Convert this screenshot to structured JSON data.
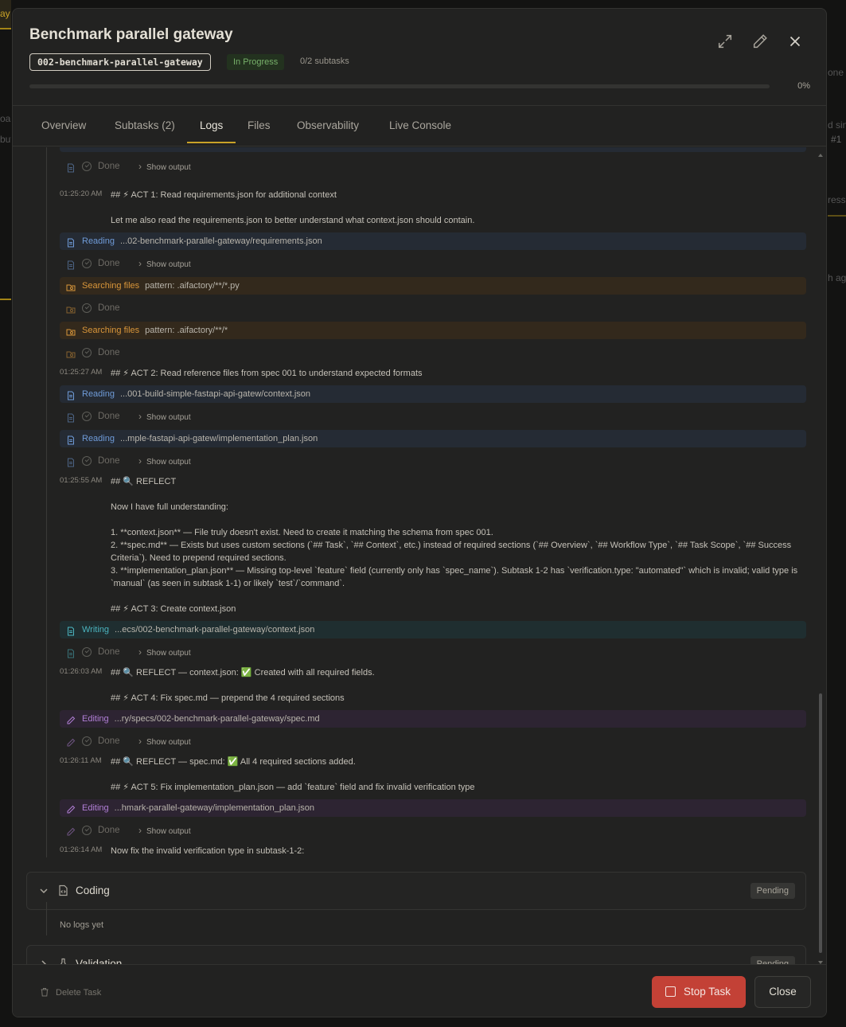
{
  "header": {
    "title": "Benchmark parallel gateway",
    "spec_id": "002-benchmark-parallel-gateway",
    "status": "In Progress",
    "subtasks": "0/2 subtasks",
    "progress_label": "0%",
    "progress": 0
  },
  "tabs": [
    "Overview",
    "Subtasks (2)",
    "Logs",
    "Files",
    "Observability",
    "Live Console"
  ],
  "active_tab": "Logs",
  "labels": {
    "done": "Done",
    "show_output": "Show output"
  },
  "log": {
    "ts1": "01:25:20 AM",
    "msg1": "## ⚡ ACT 1: Read requirements.json for additional context",
    "msg1b": "Let me also read the requirements.json to better understand what context.json should contain.",
    "read1": {
      "name": "Reading",
      "path": "...02-benchmark-parallel-gateway/requirements.json"
    },
    "search1": {
      "name": "Searching files",
      "path": "pattern: .aifactory/**/*.py"
    },
    "search2": {
      "name": "Searching files",
      "path": "pattern: .aifactory/**/*"
    },
    "ts2": "01:25:27 AM",
    "msg2": "## ⚡ ACT 2: Read reference files from spec 001 to understand expected formats",
    "read2": {
      "name": "Reading",
      "path": "...001-build-simple-fastapi-api-gatew/context.json"
    },
    "read3": {
      "name": "Reading",
      "path": "...mple-fastapi-api-gatew/implementation_plan.json"
    },
    "ts3": "01:25:55 AM",
    "msg3": "## 🔍 REFLECT",
    "msg3a": "Now I have full understanding:",
    "msg3b": "1. **context.json** — File truly doesn't exist. Need to create it matching the schema from spec 001.",
    "msg3c": "2. **spec.md** — Exists but uses custom sections (`## Task`, `## Context`, etc.) instead of required sections (`## Overview`, `## Workflow Type`, `## Task Scope`, `## Success Criteria`). Need to prepend required sections.",
    "msg3d": "3. **implementation_plan.json** — Missing top-level `feature` field (currently only has `spec_name`). Subtask 1-2 has `verification.type: \"automated\"` which is invalid; valid type is `manual` (as seen in subtask 1-1) or likely `test`/`command`.",
    "msg3e": "## ⚡ ACT 3: Create context.json",
    "write1": {
      "name": "Writing",
      "path": "...ecs/002-benchmark-parallel-gateway/context.json"
    },
    "ts4": "01:26:03 AM",
    "msg4": "## 🔍 REFLECT — context.json: ✅ Created with all required fields.",
    "msg4b": "## ⚡ ACT 4: Fix spec.md — prepend the 4 required sections",
    "edit1": {
      "name": "Editing",
      "path": "...ry/specs/002-benchmark-parallel-gateway/spec.md"
    },
    "ts5": "01:26:11 AM",
    "msg5": "## 🔍 REFLECT — spec.md: ✅ All 4 required sections added.",
    "msg5b": "## ⚡ ACT 5: Fix implementation_plan.json — add `feature` field and fix invalid verification type",
    "edit2": {
      "name": "Editing",
      "path": "...hmark-parallel-gateway/implementation_plan.json"
    },
    "ts6": "01:26:14 AM",
    "msg6": "Now fix the invalid verification type in subtask-1-2:"
  },
  "phases": {
    "coding": {
      "name": "Coding",
      "status": "Pending",
      "empty": "No logs yet"
    },
    "validation": {
      "name": "Validation",
      "status": "Pending"
    }
  },
  "footer": {
    "delete": "Delete Task",
    "stop": "Stop Task",
    "close": "Close"
  },
  "background": {
    "t1": "ay",
    "t2": "one",
    "t3": "d sin",
    "t4": "#1",
    "t5": "oar",
    "t6": "but",
    "t7": "ress",
    "t8": "h ag"
  },
  "colors": {
    "accent": "#c9a227",
    "stop": "#c34136",
    "status": "#77b06a"
  }
}
